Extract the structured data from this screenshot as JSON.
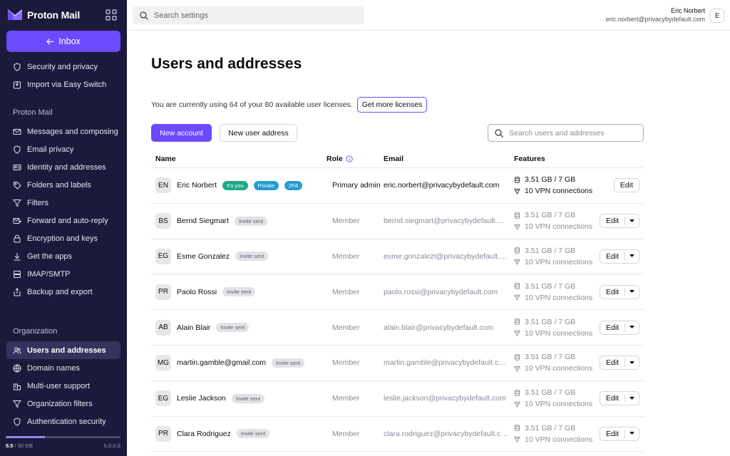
{
  "app": {
    "name": "Proton Mail"
  },
  "sidebar": {
    "inbox_label": "Inbox",
    "items_top": [
      {
        "label": "Security and privacy",
        "icon": "shield-icon"
      },
      {
        "label": "Import via Easy Switch",
        "icon": "import-icon"
      }
    ],
    "section_mail": "Proton Mail",
    "items_mail": [
      {
        "label": "Messages and composing",
        "icon": "envelope-icon"
      },
      {
        "label": "Email privacy",
        "icon": "shield-icon"
      },
      {
        "label": "Identity and addresses",
        "icon": "id-card-icon"
      },
      {
        "label": "Folders and labels",
        "icon": "tag-icon"
      },
      {
        "label": "Filters",
        "icon": "filter-icon"
      },
      {
        "label": "Forward and auto-reply",
        "icon": "forward-icon"
      },
      {
        "label": "Encryption and keys",
        "icon": "lock-icon"
      },
      {
        "label": "Get the apps",
        "icon": "download-icon"
      },
      {
        "label": "IMAP/SMTP",
        "icon": "server-icon"
      },
      {
        "label": "Backup and export",
        "icon": "export-icon"
      }
    ],
    "section_org": "Organization",
    "items_org": [
      {
        "label": "Users and addresses",
        "icon": "users-icon",
        "active": true
      },
      {
        "label": "Domain names",
        "icon": "globe-icon"
      },
      {
        "label": "Multi-user support",
        "icon": "buildings-icon"
      },
      {
        "label": "Organization filters",
        "icon": "filter-icon"
      },
      {
        "label": "Authentication security",
        "icon": "shield-icon"
      }
    ],
    "storage": {
      "used": "5.5",
      "total": "/ 30 GB",
      "version": "6.0.0 β",
      "fraction": 0.34
    }
  },
  "topbar": {
    "search_placeholder": "Search settings",
    "user_name": "Eric Norbert",
    "user_email": "eric.norbert@privacybydefault.com",
    "user_initial": "E"
  },
  "main": {
    "title": "Users and addresses",
    "license_text": "You are currently using 64 of your 80 available user licenses.",
    "get_more_label": "Get more licenses",
    "new_account_label": "New account",
    "new_address_label": "New user address",
    "search_placeholder": "Search users and addresses",
    "headers": {
      "name": "Name",
      "role": "Role",
      "email": "Email",
      "features": "Features"
    },
    "users": [
      {
        "initials": "EN",
        "name": "Eric Norbert",
        "badges": [
          {
            "text": "It's you",
            "kind": "green"
          },
          {
            "text": "Private",
            "kind": "blue"
          },
          {
            "text": "2FA",
            "kind": "blue"
          }
        ],
        "role": "Primary admin",
        "email": "eric.norbert@privacybydefault.com",
        "storage": "3.51 GB / 7 GB",
        "vpn": "10 VPN connections",
        "edit": "Edit",
        "menu": false,
        "muted": false
      },
      {
        "initials": "BS",
        "name": "Bernd Siegmart",
        "badges": [
          {
            "text": "Invite sent",
            "kind": "gray"
          }
        ],
        "role": "Member",
        "email": "bernd.siegmart@privacybydefault.com",
        "storage": "3.51 GB / 7 GB",
        "vpn": "10 VPN connections",
        "edit": "Edit",
        "menu": true,
        "muted": true
      },
      {
        "initials": "EG",
        "name": "Esme Gonzalez",
        "badges": [
          {
            "text": "Invite sent",
            "kind": "gray"
          }
        ],
        "role": "Member",
        "email": "esme.gonzalezt@privacybydefault.com",
        "storage": "3.51 GB / 7 GB",
        "vpn": "10 VPN connections",
        "edit": "Edit",
        "menu": true,
        "muted": true
      },
      {
        "initials": "PR",
        "name": "Paolo Rossi",
        "badges": [
          {
            "text": "Invite sent",
            "kind": "gray"
          }
        ],
        "role": "Member",
        "email": "paolo.rossi@privacybydefault.com",
        "storage": "3.51 GB / 7 GB",
        "vpn": "10 VPN connections",
        "edit": "Edit",
        "menu": true,
        "muted": true
      },
      {
        "initials": "AB",
        "name": "Alain Blair",
        "badges": [
          {
            "text": "Invite sent",
            "kind": "gray"
          }
        ],
        "role": "Member",
        "email": "alain.blair@privacybydefault.com",
        "storage": "3.51 GB / 7 GB",
        "vpn": "10 VPN connections",
        "edit": "Edit",
        "menu": true,
        "muted": true
      },
      {
        "initials": "MG",
        "name": "martin.gamble@gmail.com",
        "badges": [
          {
            "text": "Invite sent",
            "kind": "gray"
          }
        ],
        "role": "Member",
        "email": "martin.gamble@privacybydefault.com",
        "storage": "3.51 GB / 7 GB",
        "vpn": "10 VPN connections",
        "edit": "Edit",
        "menu": true,
        "muted": true
      },
      {
        "initials": "EG",
        "name": "Leslie Jackson",
        "badges": [
          {
            "text": "Invite sent",
            "kind": "gray"
          }
        ],
        "role": "Member",
        "email": "leslie.jackson@privacybydefault.com",
        "storage": "3.51 GB / 7 GB",
        "vpn": "10 VPN connections",
        "edit": "Edit",
        "menu": true,
        "muted": true
      },
      {
        "initials": "PR",
        "name": "Clara Rodriguez",
        "badges": [
          {
            "text": "Invite sent",
            "kind": "gray"
          }
        ],
        "role": "Member",
        "email": "clara.rodriguez@privacybydefault.com",
        "storage": "3.51 GB / 7 GB",
        "vpn": "10 VPN connections",
        "edit": "Edit",
        "menu": true,
        "muted": true
      }
    ]
  },
  "colors": {
    "accent": "#6d4aff",
    "sidebar_bg": "#1c1a3b",
    "badge_green": "#1ea885",
    "badge_blue": "#239ece"
  }
}
